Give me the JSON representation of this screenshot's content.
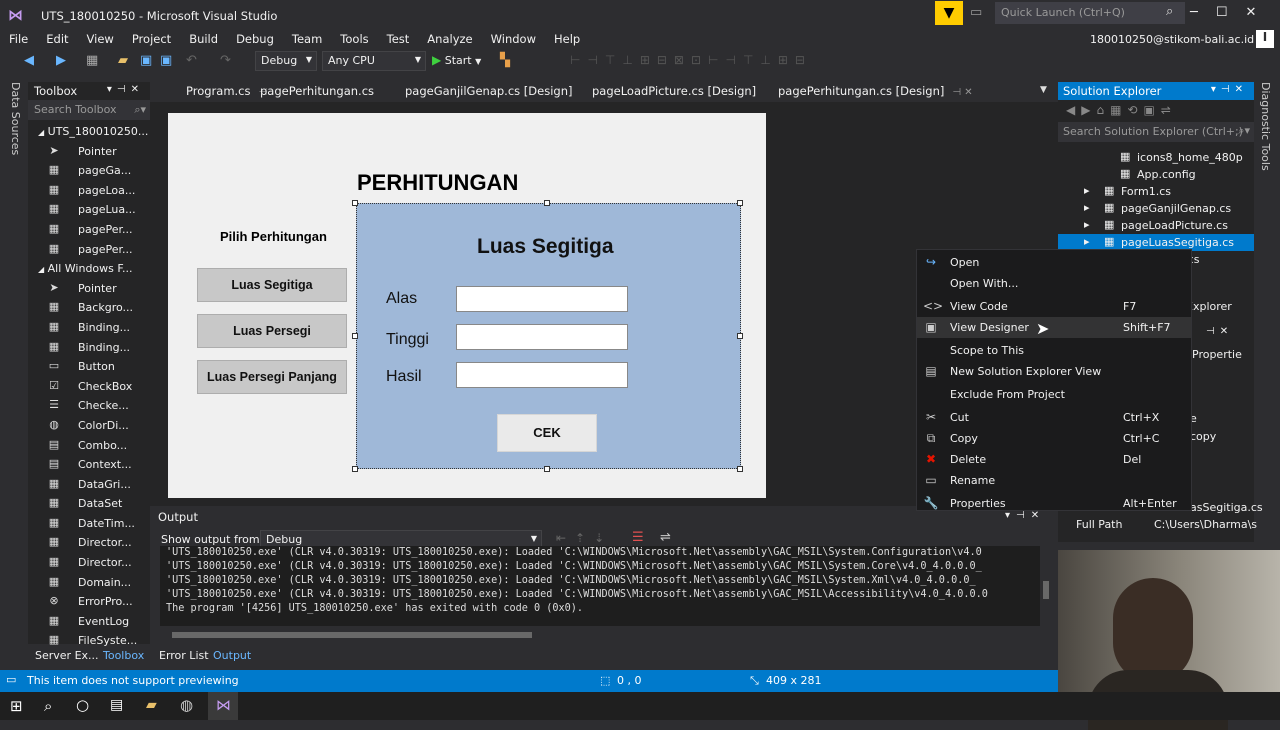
{
  "window": {
    "title": "UTS_180010250 - Microsoft Visual Studio",
    "quick_launch": "Quick Launch (Ctrl+Q)",
    "account": "180010250@stikom-bali.ac.id",
    "account_initial": "I"
  },
  "menu": [
    "File",
    "Edit",
    "View",
    "Project",
    "Build",
    "Debug",
    "Team",
    "Tools",
    "Test",
    "Analyze",
    "Window",
    "Help"
  ],
  "toolbar": {
    "config": "Debug",
    "platform": "Any CPU",
    "start": "Start"
  },
  "side_tabs": {
    "left": "Data Sources",
    "right": "Diagnostic Tools"
  },
  "toolbox": {
    "title": "Toolbox",
    "search": "Search Toolbox",
    "group1": "UTS_180010250...",
    "group1_items": [
      {
        "icon": "pointer-icon",
        "glyph": "➤",
        "label": "Pointer"
      },
      {
        "icon": "component-icon",
        "glyph": "▦",
        "label": "pageGa..."
      },
      {
        "icon": "component-icon",
        "glyph": "▦",
        "label": "pageLoa..."
      },
      {
        "icon": "component-icon",
        "glyph": "▦",
        "label": "pageLua..."
      },
      {
        "icon": "component-icon",
        "glyph": "▦",
        "label": "pagePer..."
      },
      {
        "icon": "component-icon",
        "glyph": "▦",
        "label": "pagePer..."
      }
    ],
    "group2": "All Windows F...",
    "group2_items": [
      {
        "icon": "pointer-icon",
        "glyph": "➤",
        "label": "Pointer"
      },
      {
        "icon": "background-worker-icon",
        "glyph": "▦",
        "label": "Backgro..."
      },
      {
        "icon": "binding-icon",
        "glyph": "▦",
        "label": "Binding..."
      },
      {
        "icon": "binding-icon",
        "glyph": "▦",
        "label": "Binding..."
      },
      {
        "icon": "button-icon",
        "glyph": "▭",
        "label": "Button"
      },
      {
        "icon": "checkbox-icon",
        "glyph": "☑",
        "label": "CheckBox"
      },
      {
        "icon": "checkedlist-icon",
        "glyph": "☰",
        "label": "Checke..."
      },
      {
        "icon": "color-dialog-icon",
        "glyph": "◍",
        "label": "ColorDi..."
      },
      {
        "icon": "combobox-icon",
        "glyph": "▤",
        "label": "Combo..."
      },
      {
        "icon": "context-menu-icon",
        "glyph": "▤",
        "label": "Context..."
      },
      {
        "icon": "datagrid-icon",
        "glyph": "▦",
        "label": "DataGri..."
      },
      {
        "icon": "dataset-icon",
        "glyph": "▦",
        "label": "DataSet"
      },
      {
        "icon": "datetime-icon",
        "glyph": "▦",
        "label": "DateTim..."
      },
      {
        "icon": "directory-icon",
        "glyph": "▦",
        "label": "Director..."
      },
      {
        "icon": "directory-icon",
        "glyph": "▦",
        "label": "Director..."
      },
      {
        "icon": "domain-icon",
        "glyph": "▦",
        "label": "Domain..."
      },
      {
        "icon": "error-provider-icon",
        "glyph": "⊗",
        "label": "ErrorPro..."
      },
      {
        "icon": "eventlog-icon",
        "glyph": "▦",
        "label": "EventLog"
      },
      {
        "icon": "filesystem-icon",
        "glyph": "▦",
        "label": "FileSyste..."
      }
    ]
  },
  "doc_tabs": [
    {
      "label": "Program.cs",
      "pin": "⊣"
    },
    {
      "label": "pagePerhitungan.cs",
      "pin": ""
    },
    {
      "label": "pageGanjilGenap.cs [Design]",
      "pin": ""
    },
    {
      "label": "pageLoadPicture.cs [Design]",
      "pin": ""
    },
    {
      "label": "pagePerhitungan.cs [Design]",
      "pin": "⊣ ✕"
    }
  ],
  "form": {
    "title": "PERHITUNGAN",
    "pilih_label": "Pilih Perhitungan",
    "buttons": [
      "Luas Segitiga",
      "Luas Persegi",
      "Luas Persegi Panjang"
    ],
    "panel": {
      "title": "Luas Segitiga",
      "labels": [
        "Alas",
        "Tinggi",
        "Hasil"
      ],
      "cek": "CEK"
    }
  },
  "output": {
    "title": "Output",
    "show_from_label": "Show output from:",
    "source": "Debug",
    "lines": [
      "'UTS_180010250.exe' (CLR v4.0.30319: UTS_180010250.exe): Loaded 'C:\\WINDOWS\\Microsoft.Net\\assembly\\GAC_MSIL\\System.Configuration\\v4.0",
      "'UTS_180010250.exe' (CLR v4.0.30319: UTS_180010250.exe): Loaded 'C:\\WINDOWS\\Microsoft.Net\\assembly\\GAC_MSIL\\System.Core\\v4.0_4.0.0.0_",
      "'UTS_180010250.exe' (CLR v4.0.30319: UTS_180010250.exe): Loaded 'C:\\WINDOWS\\Microsoft.Net\\assembly\\GAC_MSIL\\System.Xml\\v4.0_4.0.0.0_",
      "'UTS_180010250.exe' (CLR v4.0.30319: UTS_180010250.exe): Loaded 'C:\\WINDOWS\\Microsoft.Net\\assembly\\GAC_MSIL\\Accessibility\\v4.0_4.0.0.0",
      "The program '[4256] UTS_180010250.exe' has exited with code 0 (0x0)."
    ]
  },
  "solution_explorer": {
    "title": "Solution Explorer",
    "search": "Search Solution Explorer (Ctrl+;)",
    "items": [
      "icons8_home_480p",
      "App.config",
      "Form1.cs",
      "pageGanjilGenap.cs",
      "pageLoadPicture.cs",
      "pageLuasSegitiga.cs",
      "...gan.cs"
    ],
    "partial_explorer": "Explorer",
    "partial_properties": "Propertie",
    "partial_e": "e",
    "partial_copy": "copy",
    "partial_file": "asSegitiga.cs",
    "full_path_label": "Full Path",
    "full_path_value": "C:\\Users\\Dharma\\s"
  },
  "context_menu": [
    {
      "icon": "open-icon",
      "glyph": "↪",
      "label": "Open",
      "shortcut": ""
    },
    {
      "icon": "",
      "glyph": "",
      "label": "Open With...",
      "shortcut": ""
    },
    {
      "icon": "code-icon",
      "glyph": "<>",
      "label": "View Code",
      "shortcut": "F7"
    },
    {
      "icon": "designer-icon",
      "glyph": "▣",
      "label": "View Designer",
      "shortcut": "Shift+F7"
    },
    {
      "icon": "",
      "glyph": "",
      "label": "Scope to This",
      "shortcut": ""
    },
    {
      "icon": "new-explorer-icon",
      "glyph": "▤",
      "label": "New Solution Explorer View",
      "shortcut": ""
    },
    {
      "icon": "",
      "glyph": "",
      "label": "Exclude From Project",
      "shortcut": ""
    },
    {
      "icon": "cut-icon",
      "glyph": "✂",
      "label": "Cut",
      "shortcut": "Ctrl+X"
    },
    {
      "icon": "copy-icon",
      "glyph": "⧉",
      "label": "Copy",
      "shortcut": "Ctrl+C"
    },
    {
      "icon": "delete-icon",
      "glyph": "✖",
      "label": "Delete",
      "shortcut": "Del"
    },
    {
      "icon": "rename-icon",
      "glyph": "▭",
      "label": "Rename",
      "shortcut": ""
    },
    {
      "icon": "properties-icon",
      "glyph": "🔧",
      "label": "Properties",
      "shortcut": "Alt+Enter"
    }
  ],
  "bottom_tabs": {
    "left": [
      "Server Ex...",
      "Toolbox"
    ],
    "right": [
      "Error List",
      "Output"
    ]
  },
  "status": {
    "message": "This item does not support previewing",
    "position": "0 , 0",
    "size": "409 x 281"
  },
  "colors": {
    "accent": "#007acc",
    "panel": "#9fb8d8",
    "delete": "#e51400"
  }
}
